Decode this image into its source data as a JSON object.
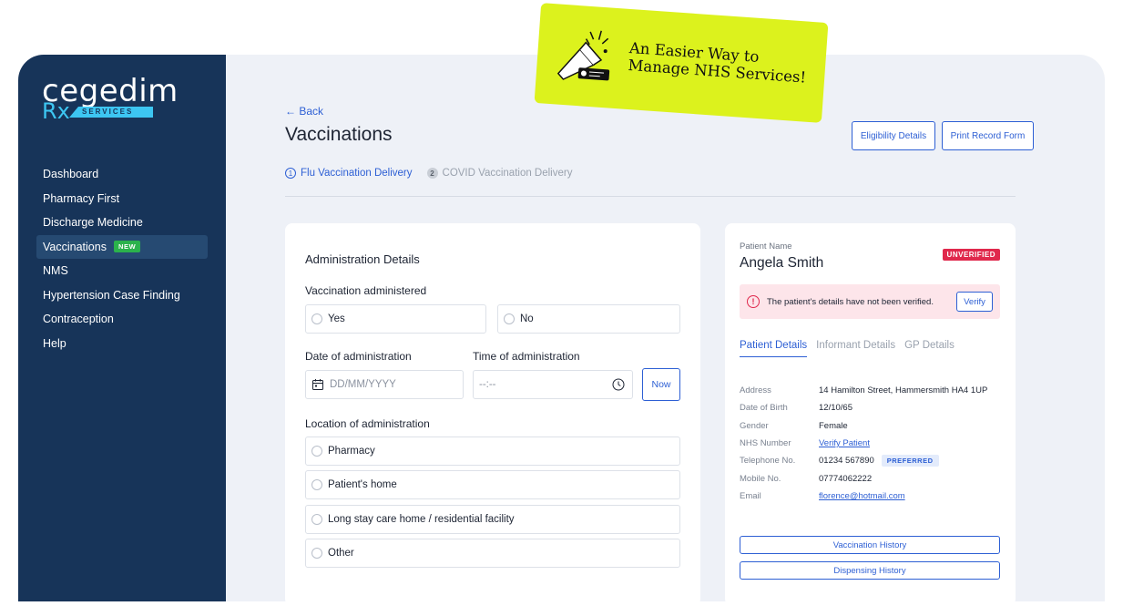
{
  "promo": {
    "line1": "An Easier Way to",
    "line2": "Manage NHS Services!"
  },
  "brand": {
    "name": "cegedim",
    "rx": "Rx",
    "services": "SERVICES"
  },
  "sidebar": {
    "items": [
      {
        "label": "Dashboard"
      },
      {
        "label": "Pharmacy First"
      },
      {
        "label": "Discharge Medicine"
      },
      {
        "label": "Vaccinations",
        "badge": "NEW",
        "active": true
      },
      {
        "label": "NMS"
      },
      {
        "label": "Hypertension Case Finding"
      },
      {
        "label": "Contraception"
      },
      {
        "label": "Help"
      }
    ]
  },
  "header": {
    "back": "← Back",
    "title": "Vaccinations",
    "eligibility_btn": "Eligibility Details",
    "print_btn": "Print Record Form"
  },
  "steps": [
    {
      "num": "1",
      "label": "Flu Vaccination Delivery",
      "active": true
    },
    {
      "num": "2",
      "label": "COVID Vaccination Delivery",
      "active": false
    }
  ],
  "form": {
    "section_title": "Administration Details",
    "vacc_label": "Vaccination administered",
    "yes": "Yes",
    "no": "No",
    "date_label": "Date of administration",
    "date_placeholder": "DD/MM/YYYY",
    "time_label": "Time of administration",
    "time_placeholder": "--:--",
    "now_btn": "Now",
    "location_label": "Location of administration",
    "locations": [
      "Pharmacy",
      "Patient's home",
      "Long stay care home / residential facility",
      "Other"
    ]
  },
  "patient": {
    "name_label": "Patient Name",
    "name": "Angela Smith",
    "status": "UNVERIFIED",
    "alert": "The patient's details have not been verified.",
    "verify_btn": "Verify",
    "tabs": [
      "Patient Details",
      "Informant Details",
      "GP Details"
    ],
    "details": [
      {
        "label": "Address",
        "value": "14 Hamilton Street, Hammersmith HA4 1UP"
      },
      {
        "label": "Date of Birth",
        "value": "12/10/65"
      },
      {
        "label": "Gender",
        "value": "Female"
      },
      {
        "label": "NHS Number",
        "value": "Verify Patient"
      },
      {
        "label": "Telephone No.",
        "value": "01234 567890",
        "tag": "PREFERRED"
      },
      {
        "label": "Mobile No.",
        "value": "07774062222"
      },
      {
        "label": "Email",
        "value": "florence@hotmail.com"
      }
    ],
    "history_btn": "Vaccination History",
    "dispensing_btn": "Dispensing History"
  },
  "colors": {
    "sidebar": "#173459",
    "accent": "#2d5fd4",
    "alert": "#e0284c",
    "promo": "#dcf21d",
    "new_badge": "#2bb24c"
  }
}
